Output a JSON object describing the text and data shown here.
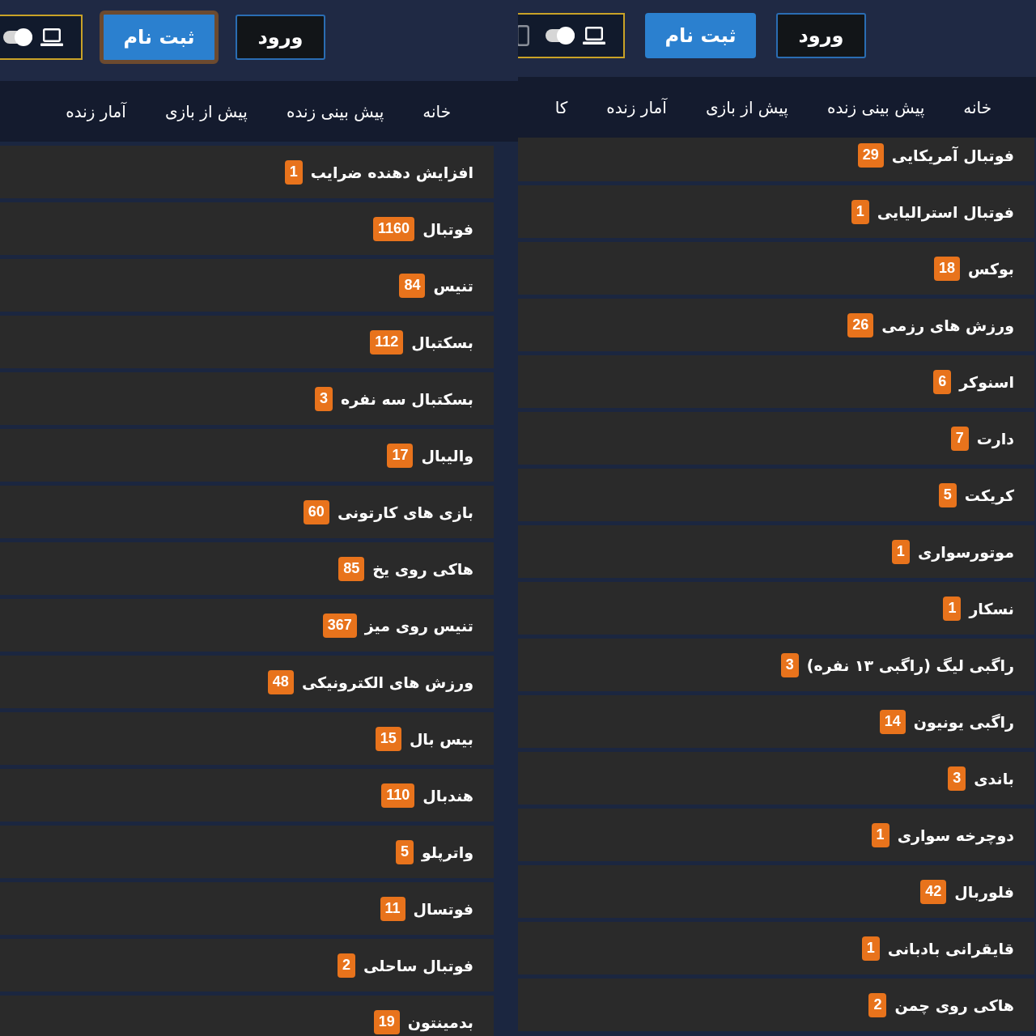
{
  "panels": [
    {
      "header": {
        "buttons": [
          {
            "label": "ورود",
            "kind": "outline",
            "focused": false
          },
          {
            "label": "ثبت نام",
            "kind": "primary",
            "focused": false
          }
        ],
        "display_toggle": {
          "on": true
        }
      },
      "nav": [
        "خانه",
        "پیش بینی زنده",
        "پیش از بازی",
        "آمار زنده",
        "کا"
      ],
      "sports": [
        {
          "name": "فوتبال آمریکایی",
          "count": "29"
        },
        {
          "name": "فوتبال استرالیایی",
          "count": "1"
        },
        {
          "name": "بوکس",
          "count": "18"
        },
        {
          "name": "ورزش های رزمی",
          "count": "26"
        },
        {
          "name": "اسنوکر",
          "count": "6"
        },
        {
          "name": "دارت",
          "count": "7"
        },
        {
          "name": "کریکت",
          "count": "5"
        },
        {
          "name": "موتورسواری",
          "count": "1"
        },
        {
          "name": "نسکار",
          "count": "1"
        },
        {
          "name": "راگبی لیگ (راگبی ۱۳ نفره)",
          "count": "3"
        },
        {
          "name": "راگبی یونیون",
          "count": "14"
        },
        {
          "name": "باندی",
          "count": "3"
        },
        {
          "name": "دوچرخه سواری",
          "count": "1"
        },
        {
          "name": "فلوربال",
          "count": "42"
        },
        {
          "name": "قایقرانی بادبانی",
          "count": "1"
        },
        {
          "name": "هاکی روی چمن",
          "count": "2"
        }
      ]
    },
    {
      "header": {
        "buttons": [
          {
            "label": "ورود",
            "kind": "outline",
            "focused": false
          },
          {
            "label": "ثبت نام",
            "kind": "primary",
            "focused": true
          }
        ],
        "display_toggle": {
          "on": true
        }
      },
      "nav": [
        "خانه",
        "پیش بینی زنده",
        "پیش از بازی",
        "آمار زنده"
      ],
      "sports": [
        {
          "name": "افزایش دهنده ضرایب",
          "count": "1"
        },
        {
          "name": "فوتبال",
          "count": "1160"
        },
        {
          "name": "تنیس",
          "count": "84"
        },
        {
          "name": "بسکتبال",
          "count": "112"
        },
        {
          "name": "بسکتبال سه نفره",
          "count": "3"
        },
        {
          "name": "والیبال",
          "count": "17"
        },
        {
          "name": "بازی های کارتونی",
          "count": "60"
        },
        {
          "name": "هاکی روی یخ",
          "count": "85"
        },
        {
          "name": "تنیس روی میز",
          "count": "367"
        },
        {
          "name": "ورزش های الکترونیکی",
          "count": "48"
        },
        {
          "name": "بیس بال",
          "count": "15"
        },
        {
          "name": "هندبال",
          "count": "110"
        },
        {
          "name": "واترپلو",
          "count": "5"
        },
        {
          "name": "فوتسال",
          "count": "11"
        },
        {
          "name": "فوتبال ساحلی",
          "count": "2"
        },
        {
          "name": "بدمینتون",
          "count": "19"
        }
      ]
    }
  ]
}
